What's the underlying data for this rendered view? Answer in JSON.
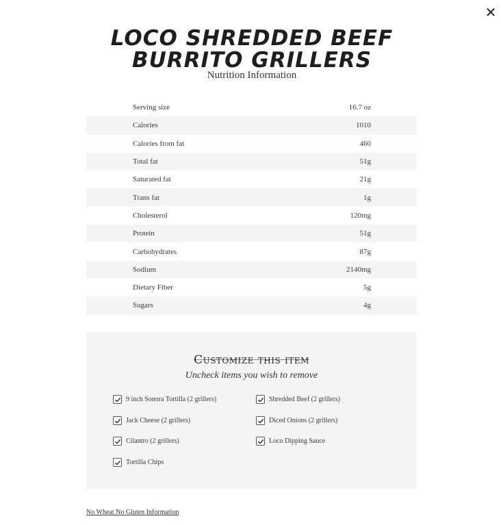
{
  "close_label": "✕",
  "title_line1": "LOCO SHREDDED BEEF",
  "title_line2": "BURRITO GRILLERS",
  "subtitle": "Nutrition Information",
  "nutrition": [
    {
      "label": "Serving size",
      "value": "16.7 oz"
    },
    {
      "label": "Calories",
      "value": "1010"
    },
    {
      "label": "Calories from fat",
      "value": "460"
    },
    {
      "label": "Total fat",
      "value": "51g"
    },
    {
      "label": "Saturated fat",
      "value": "21g"
    },
    {
      "label": "Trans fat",
      "value": "1g"
    },
    {
      "label": "Cholesterol",
      "value": "120mg"
    },
    {
      "label": "Protein",
      "value": "51g"
    },
    {
      "label": "Carbohydrates",
      "value": "87g"
    },
    {
      "label": "Sodium",
      "value": "2140mg"
    },
    {
      "label": "Dietary Fiber",
      "value": "5g"
    },
    {
      "label": "Sugars",
      "value": "4g"
    }
  ],
  "customize": {
    "title": "Customize this item",
    "subtitle": "Uncheck items you wish to remove",
    "options": [
      {
        "label": "9 inch Sonora Tortilla (2 grillers)",
        "checked": true
      },
      {
        "label": "Shredded Beef (2 grillers)",
        "checked": true
      },
      {
        "label": "Jack Cheese (2 grillers)",
        "checked": true
      },
      {
        "label": "Diced Onions (2 grillers)",
        "checked": true
      },
      {
        "label": "Cilantro (2 grillers)",
        "checked": true
      },
      {
        "label": "Loco Dipping Sauce",
        "checked": true
      },
      {
        "label": "Tortilla Chips",
        "checked": true
      }
    ]
  },
  "footer_link": "No Wheat No Gluten Information"
}
